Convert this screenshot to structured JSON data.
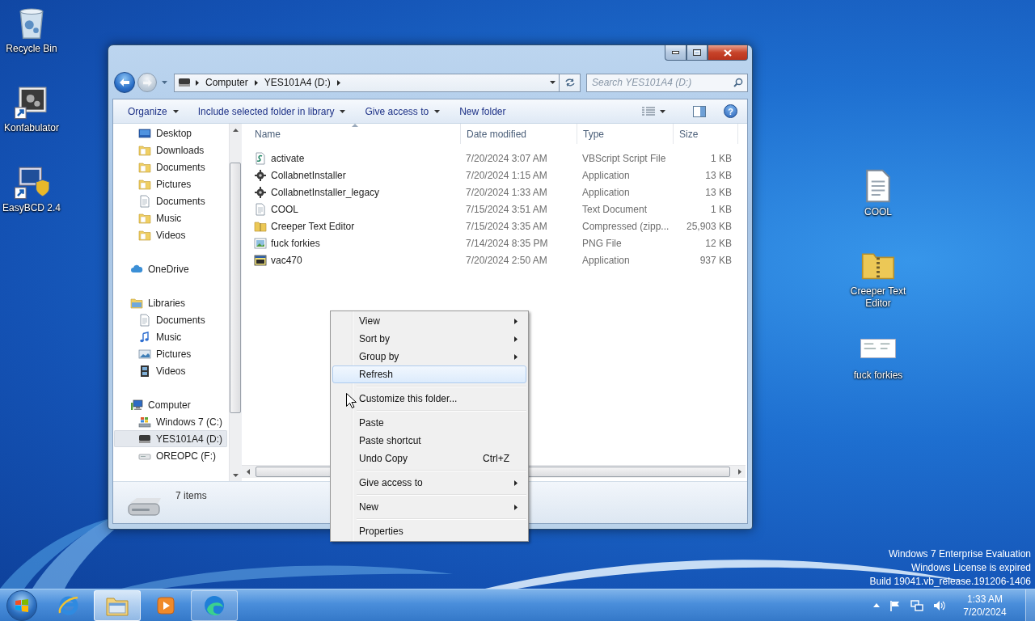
{
  "desktop": {
    "left_icons": [
      {
        "label": "Recycle Bin",
        "kind": "recycle"
      },
      {
        "label": "Konfabulator",
        "kind": "gears"
      },
      {
        "label": "EasyBCD 2.4",
        "kind": "easybcd"
      }
    ],
    "right_icons": [
      {
        "label": "COOL",
        "kind": "text"
      },
      {
        "label": "Creeper Text Editor",
        "kind": "zip"
      },
      {
        "label": "fuck forkies",
        "kind": "thumbnail"
      }
    ],
    "license_notice": [
      "Windows 7 Enterprise Evaluation",
      "Windows License is expired",
      "Build 19041.vb_release.191206-1406"
    ]
  },
  "window": {
    "address_bar": {
      "crumbs": [
        "Computer",
        "YES101A4 (D:)"
      ]
    },
    "search": {
      "placeholder": "Search YES101A4 (D:)"
    },
    "toolbar": {
      "buttons": [
        {
          "label": "Organize",
          "dropdown": true
        },
        {
          "label": "Include selected folder in library",
          "dropdown": true
        },
        {
          "label": "Give access to",
          "dropdown": true
        },
        {
          "label": "New folder",
          "dropdown": false
        }
      ],
      "help": "?"
    },
    "sidebar": {
      "tree": [
        {
          "children": [
            {
              "label": "Desktop",
              "kind": "desktop",
              "selected": false
            },
            {
              "label": "Downloads",
              "kind": "folder",
              "selected": false
            },
            {
              "label": "Documents",
              "kind": "folder",
              "selected": false
            },
            {
              "label": "Pictures",
              "kind": "folder",
              "selected": false
            },
            {
              "label": "Documents",
              "kind": "document",
              "selected": false
            },
            {
              "label": "Music",
              "kind": "folder",
              "selected": false
            },
            {
              "label": "Videos",
              "kind": "folder",
              "selected": false
            }
          ]
        },
        {
          "label": "OneDrive",
          "kind": "cloud",
          "selected": false
        },
        {
          "label": "Libraries",
          "kind": "libraries",
          "selected": false,
          "children": [
            {
              "label": "Documents",
              "kind": "document",
              "selected": false
            },
            {
              "label": "Music",
              "kind": "music",
              "selected": false
            },
            {
              "label": "Pictures",
              "kind": "pictures",
              "selected": false
            },
            {
              "label": "Videos",
              "kind": "videos",
              "selected": false
            }
          ]
        },
        {
          "label": "Computer",
          "kind": "computer",
          "selected": false,
          "children": [
            {
              "label": "Windows 7 (C:)",
              "kind": "system-drive",
              "selected": false
            },
            {
              "label": "YES101A4 (D:)",
              "kind": "drive",
              "selected": true
            },
            {
              "label": "OREOPC (F:)",
              "kind": "usb-drive",
              "selected": false
            }
          ]
        }
      ]
    },
    "table": {
      "columns": [
        "Name",
        "Date modified",
        "Type",
        "Size"
      ],
      "rows": [
        {
          "name": "activate",
          "date": "7/20/2024 3:07 AM",
          "type": "VBScript Script File",
          "size": "1 KB",
          "kind": "script"
        },
        {
          "name": "CollabnetInstaller",
          "date": "7/20/2024 1:15 AM",
          "type": "Application",
          "size": "13 KB",
          "kind": "installer"
        },
        {
          "name": "CollabnetInstaller_legacy",
          "date": "7/20/2024 1:33 AM",
          "type": "Application",
          "size": "13 KB",
          "kind": "installer"
        },
        {
          "name": "COOL",
          "date": "7/15/2024 3:51 AM",
          "type": "Text Document",
          "size": "1 KB",
          "kind": "text"
        },
        {
          "name": "Creeper Text Editor",
          "date": "7/15/2024 3:35 AM",
          "type": "Compressed (zipp...",
          "size": "25,903 KB",
          "kind": "zip"
        },
        {
          "name": "fuck forkies",
          "date": "7/14/2024 8:35 PM",
          "type": "PNG File",
          "size": "12 KB",
          "kind": "image"
        },
        {
          "name": "vac470",
          "date": "7/20/2024 2:50 AM",
          "type": "Application",
          "size": "937 KB",
          "kind": "app"
        }
      ]
    },
    "details_pane": {
      "text": "7 items"
    }
  },
  "context_menu": {
    "groups": [
      {
        "items": [
          {
            "label": "View",
            "submenu": true,
            "selected": false
          },
          {
            "label": "Sort by",
            "submenu": true,
            "selected": false
          },
          {
            "label": "Group by",
            "submenu": true,
            "selected": false
          },
          {
            "label": "Refresh",
            "submenu": false,
            "selected": true
          }
        ]
      },
      {
        "items": [
          {
            "label": "Customize this folder...",
            "submenu": false,
            "selected": false
          }
        ]
      },
      {
        "items": [
          {
            "label": "Paste",
            "submenu": false,
            "selected": false
          },
          {
            "label": "Paste shortcut",
            "submenu": false,
            "selected": false
          },
          {
            "label": "Undo Copy",
            "shortcut": "Ctrl+Z",
            "submenu": false,
            "selected": false
          }
        ]
      },
      {
        "items": [
          {
            "label": "Give access to",
            "submenu": true,
            "selected": false
          }
        ]
      },
      {
        "items": [
          {
            "label": "New",
            "submenu": true,
            "selected": false
          }
        ]
      },
      {
        "items": [
          {
            "label": "Properties",
            "submenu": false,
            "selected": false
          }
        ]
      }
    ]
  },
  "taskbar": {
    "apps": [
      {
        "kind": "ie",
        "running": false,
        "active": false
      },
      {
        "kind": "explorer",
        "running": true,
        "active": true
      },
      {
        "kind": "media",
        "running": false,
        "active": false
      },
      {
        "kind": "edge",
        "running": true,
        "active": false
      }
    ],
    "clock": {
      "time": "1:33 AM",
      "date": "7/20/2024"
    }
  }
}
